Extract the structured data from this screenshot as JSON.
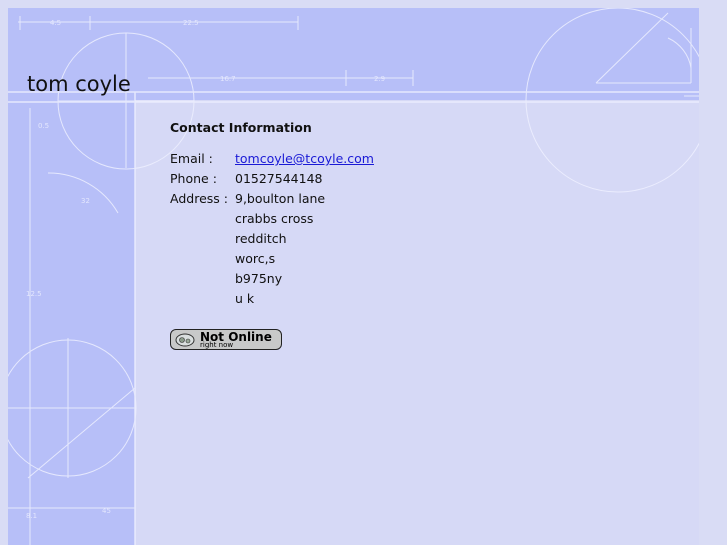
{
  "site": {
    "title": "tom coyle"
  },
  "contact": {
    "heading": "Contact Information",
    "email_label": "Email :",
    "email": "tomcoyle@tcoyle.com",
    "phone_label": "Phone :",
    "phone": "01527544148",
    "address_label": "Address :",
    "address_lines": [
      "9,boulton lane",
      "crabbs cross",
      "redditch",
      "worc,s",
      "b975ny",
      "u k"
    ]
  },
  "status": {
    "main": "Not Online",
    "sub": "right now"
  },
  "decoration": {
    "measure_labels": [
      "4.5",
      "22.5",
      "16.7",
      "2.9",
      "0.5",
      "12.5",
      "8.1",
      "45",
      "32"
    ]
  },
  "colors": {
    "background": "#d6d9f6",
    "band": "#b7bff8",
    "link": "#1a1ad6"
  }
}
